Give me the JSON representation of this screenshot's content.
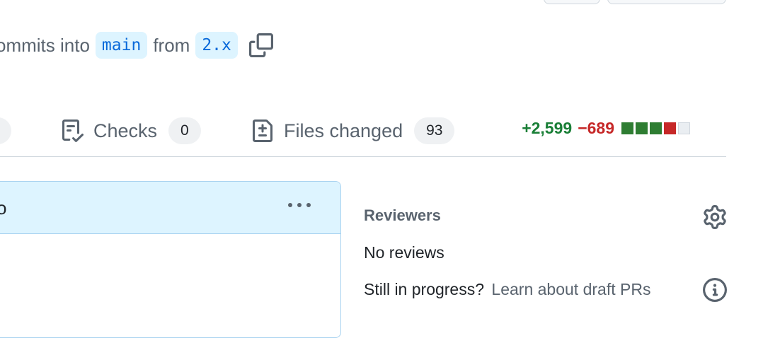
{
  "merge": {
    "text_before": "ommits into",
    "base_branch": "main",
    "text_middle": "from",
    "head_branch": "2.x"
  },
  "tabs": [
    {
      "label": "Checks",
      "count": "0"
    },
    {
      "label": "Files changed",
      "count": "93"
    }
  ],
  "diffstat": {
    "additions": "+2,599",
    "deletions": "−689",
    "blocks": [
      "added",
      "added",
      "added",
      "deleted",
      "neutral"
    ]
  },
  "timeline": {
    "header_text_clipped": "o"
  },
  "sidebar": {
    "reviewers_heading": "Reviewers",
    "reviews_status": "No reviews",
    "draft_prompt": "Still in progress?",
    "draft_link": "Learn about draft PRs"
  },
  "icons": {
    "copy": "copy-icon",
    "checks": "checklist-icon",
    "files": "file-diff-icon",
    "kebab": "kebab-horizontal-icon",
    "settings": "gear-icon",
    "info": "info-icon"
  },
  "colors": {
    "added": "#2e7d32",
    "deleted": "#c62828",
    "neutral": "#eaeef2",
    "branch_bg": "#ddf4ff",
    "branch_text": "#0969da"
  }
}
